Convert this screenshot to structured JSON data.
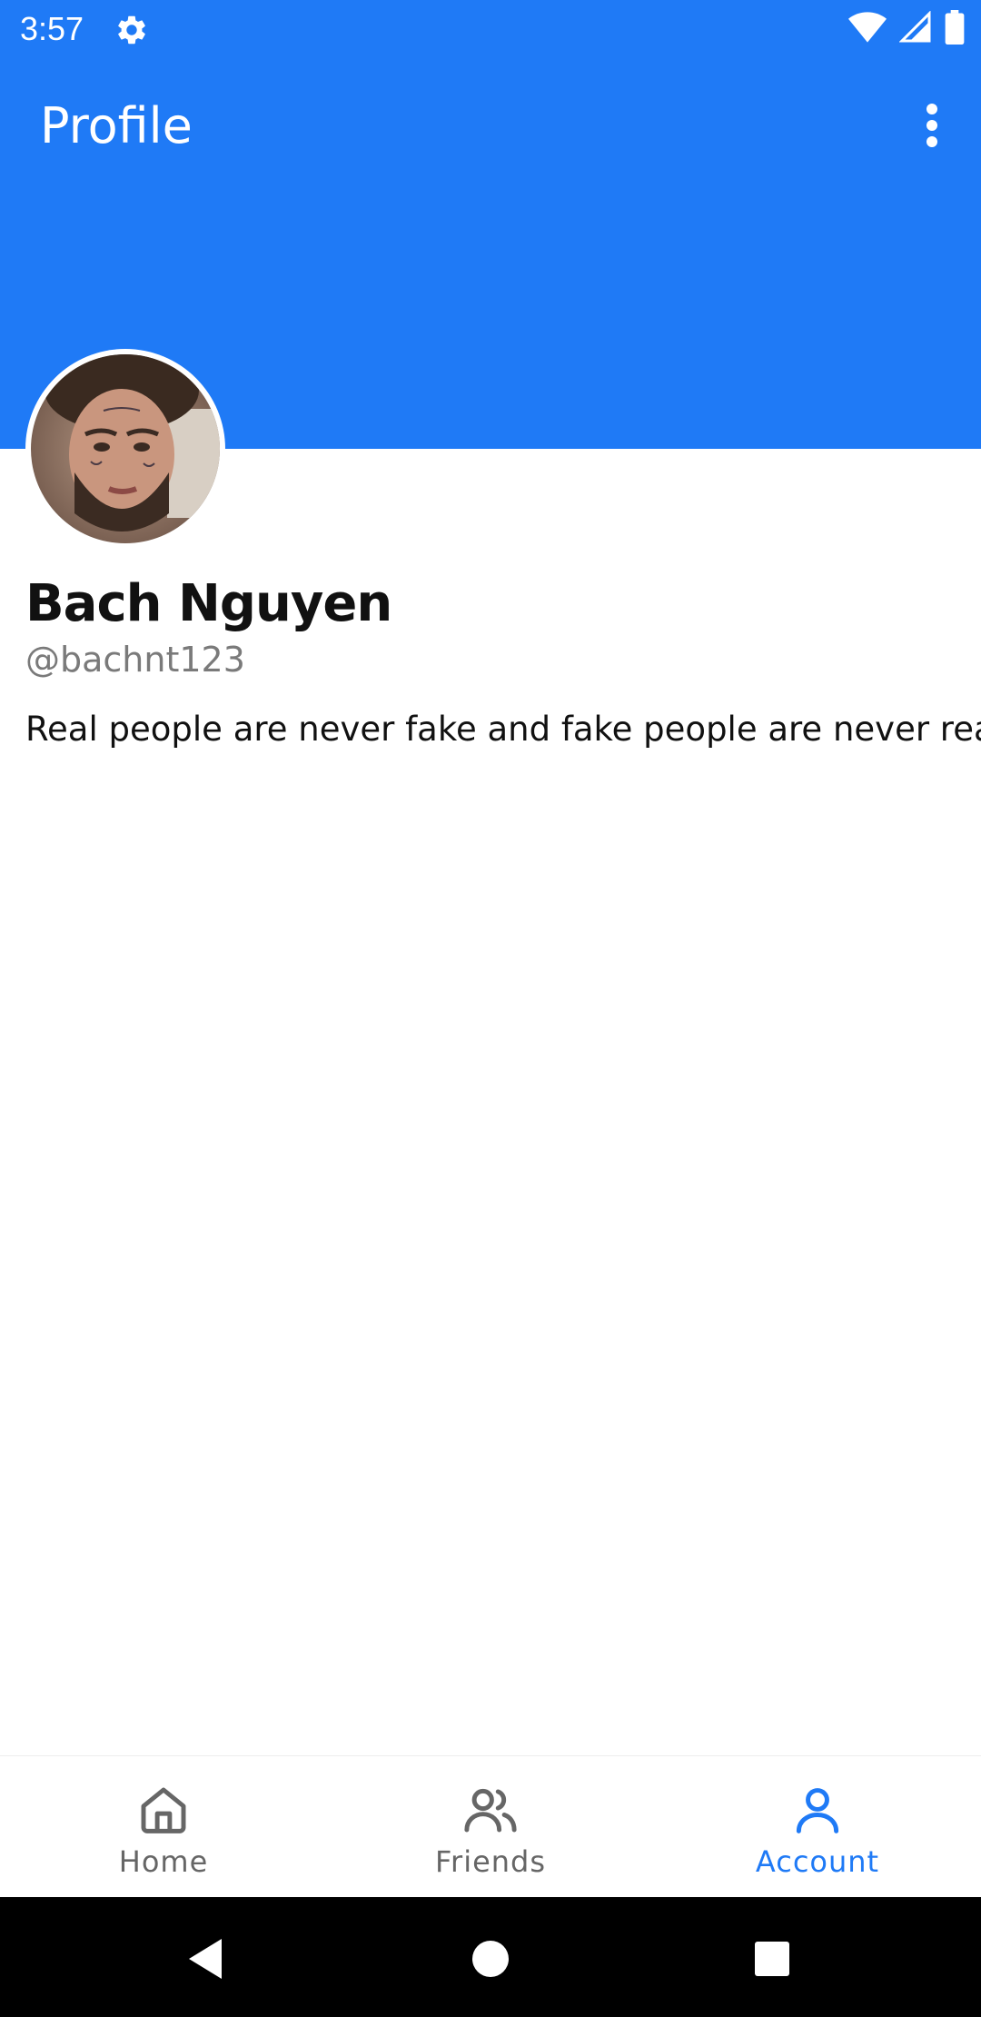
{
  "status_bar": {
    "time": "3:57",
    "icons": [
      "gear-icon",
      "wifi-icon",
      "signal-icon",
      "battery-icon"
    ]
  },
  "app_bar": {
    "title": "Profile",
    "menu_icon": "more-vert-icon"
  },
  "profile": {
    "avatar_icon": "profile-photo",
    "name": "Bach Nguyen",
    "handle": "@bachnt123",
    "bio": "Real people are never fake and fake people are never real"
  },
  "bottom_nav": {
    "items": [
      {
        "label": "Home",
        "icon": "home-icon",
        "active": false
      },
      {
        "label": "Friends",
        "icon": "friends-icon",
        "active": false
      },
      {
        "label": "Account",
        "icon": "account-icon",
        "active": true
      }
    ]
  },
  "system_nav": {
    "icons": [
      "back-icon",
      "home-circle-icon",
      "recents-icon"
    ]
  },
  "colors": {
    "primary": "#1f7af6",
    "inactive": "#666666",
    "handle": "#7a7a7a",
    "text": "#111111"
  }
}
